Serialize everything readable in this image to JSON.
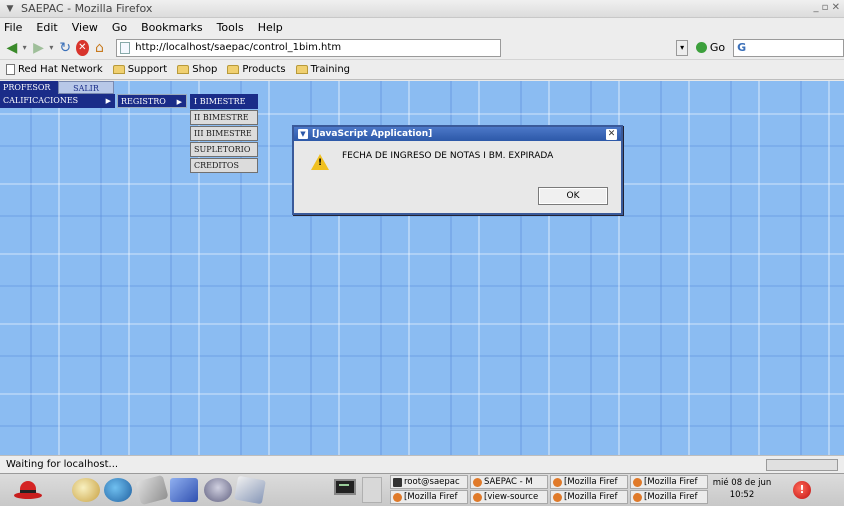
{
  "window": {
    "title": "SAEPAC - Mozilla Firefox",
    "controls": "_ ▫ ✕"
  },
  "menubar": {
    "items": [
      "File",
      "Edit",
      "View",
      "Go",
      "Bookmarks",
      "Tools",
      "Help"
    ]
  },
  "navbar": {
    "url": "http://localhost/saepac/control_1bim.htm",
    "go_label": "Go",
    "search_value": "G"
  },
  "bookmarks": {
    "items": [
      "Red Hat Network",
      "Support",
      "Shop",
      "Products",
      "Training"
    ]
  },
  "page": {
    "top_menu": [
      "PROFESOR",
      "SALIR"
    ],
    "calificaciones_label": "CALIFICACIONES",
    "registro_label": "REGISTRO",
    "arrow": "▶",
    "submenu": [
      "I BIMESTRE",
      "II BIMESTRE",
      "III BIMESTRE",
      "SUPLETORIO",
      "CREDITOS"
    ]
  },
  "dialog": {
    "title": "[JavaScript Application]",
    "message": "FECHA DE INGRESO DE NOTAS I BM. EXPIRADA",
    "ok_label": "OK",
    "warn_mark": "!"
  },
  "statusbar": {
    "text": "Waiting for localhost..."
  },
  "taskbar": {
    "tasks": [
      "root@saepac",
      "SAEPAC - M",
      "[Mozilla Firef",
      "[Mozilla Firef",
      "[Mozilla Firef",
      "[view-source",
      "[Mozilla Firef",
      "[Mozilla Firef"
    ],
    "clock_date": "mié 08 de jun",
    "clock_time": "10:52"
  },
  "colors": {
    "menu_dark_blue": "#1a2c88",
    "content_blue": "#8bbcf2",
    "dialog_title": "#2c58a8"
  }
}
